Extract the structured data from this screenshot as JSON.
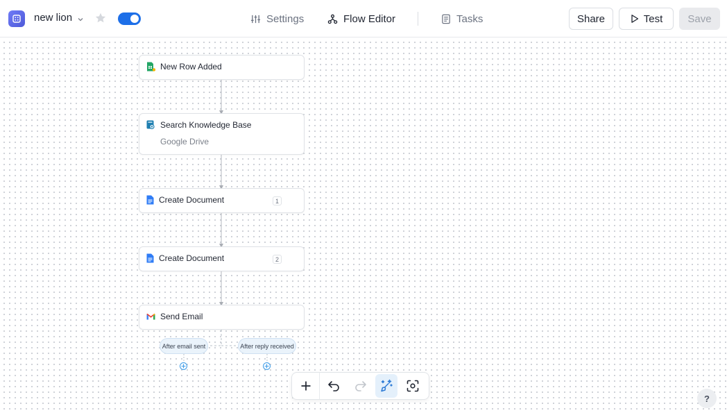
{
  "header": {
    "flow_name": "new lion",
    "enabled": true,
    "nav": {
      "settings": "Settings",
      "flow_editor": "Flow Editor",
      "tasks": "Tasks"
    },
    "buttons": {
      "share": "Share",
      "test": "Test",
      "save": "Save"
    }
  },
  "nodes": [
    {
      "title": "New Row Added",
      "icon": "google-sheets-trigger-icon"
    },
    {
      "title": "Search Knowledge Base",
      "subtitle": "Google Drive",
      "icon": "knowledge-base-icon"
    },
    {
      "title": "Create Document",
      "badge": "1",
      "icon": "google-docs-icon"
    },
    {
      "title": "Create Document",
      "badge": "2",
      "icon": "google-docs-icon"
    },
    {
      "title": "Send Email",
      "icon": "gmail-icon"
    }
  ],
  "branches": {
    "email_sent": "After email sent",
    "reply_received": "After reply received"
  },
  "toolbar": {
    "items": [
      "add-icon",
      "undo-icon",
      "redo-icon",
      "auto-layout-icon",
      "fit-view-icon"
    ]
  },
  "help_label": "?",
  "colors": {
    "accent": "#1d6fe8",
    "toggle_on": "#1d6fe8",
    "branch_pill_bg": "#eaf3fb"
  }
}
